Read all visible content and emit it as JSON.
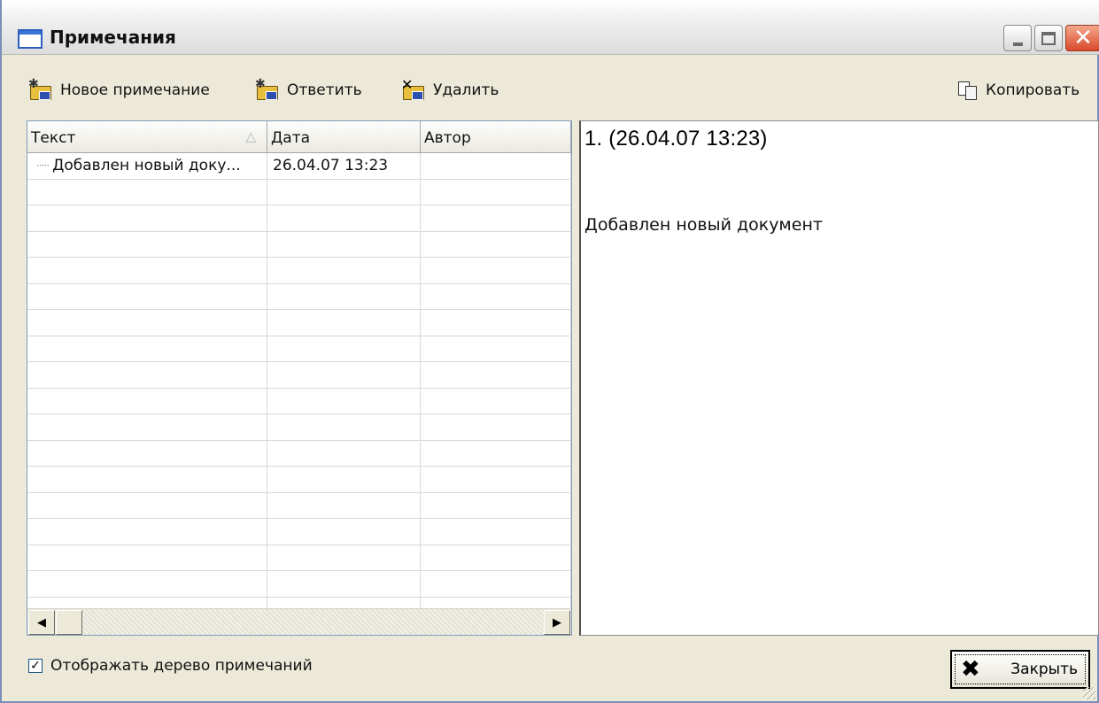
{
  "window": {
    "title": "Примечания",
    "controls": {
      "minimize": "minimize",
      "maximize": "maximize",
      "close": "close"
    }
  },
  "toolbar": {
    "new_note": "Новое примечание",
    "reply": "Ответить",
    "delete": "Удалить",
    "copy": "Копировать"
  },
  "list": {
    "columns": [
      "Текст",
      "Дата",
      "Автор"
    ],
    "sort_column": "Текст",
    "rows": [
      {
        "text": "Добавлен новый доку...",
        "date": "26.04.07 13:23",
        "author": ""
      }
    ]
  },
  "preview": {
    "heading": "1.  (26.04.07 13:23)",
    "body": "Добавлен новый документ"
  },
  "footer": {
    "show_tree_label": "Отображать дерево примечаний",
    "show_tree_checked": true,
    "close_label": "Закрыть"
  },
  "colors": {
    "window_bg": "#ece9d8",
    "close_button_red": "#d9492a",
    "title_icon_blue": "#2a5fbf"
  }
}
